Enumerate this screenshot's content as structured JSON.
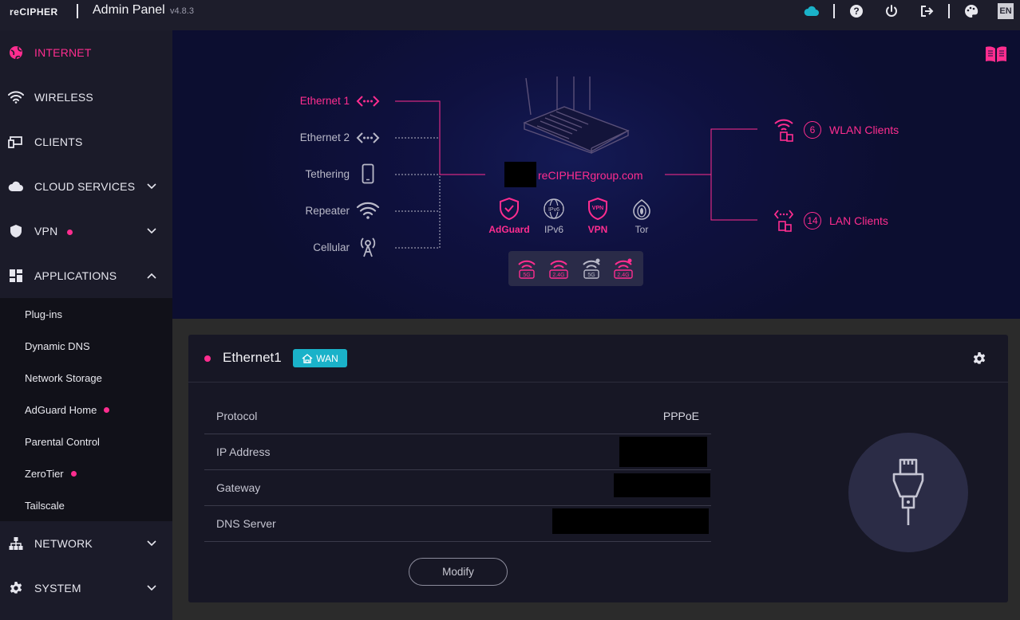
{
  "topbar": {
    "brand": "reCIPHER",
    "title": "Admin Panel",
    "version": "v4.8.3",
    "icons": [
      "cloud-icon",
      "help-icon",
      "power-icon",
      "logout-icon",
      "palette-icon"
    ],
    "language": "EN"
  },
  "sidebar": {
    "items": [
      {
        "label": "INTERNET",
        "icon": "globe-icon",
        "active": true
      },
      {
        "label": "WIRELESS",
        "icon": "wifi-icon"
      },
      {
        "label": "CLIENTS",
        "icon": "devices-icon"
      },
      {
        "label": "CLOUD SERVICES",
        "icon": "cloud-icon",
        "chevron": "down"
      },
      {
        "label": "VPN",
        "icon": "shield-icon",
        "chevron": "down",
        "dot": true
      },
      {
        "label": "APPLICATIONS",
        "icon": "apps-icon",
        "chevron": "up"
      },
      {
        "label": "NETWORK",
        "icon": "network-icon",
        "chevron": "down"
      },
      {
        "label": "SYSTEM",
        "icon": "gear-icon",
        "chevron": "down"
      }
    ],
    "submenu": [
      {
        "label": "Plug-ins"
      },
      {
        "label": "Dynamic DNS"
      },
      {
        "label": "Network Storage"
      },
      {
        "label": "AdGuard Home",
        "dot": true
      },
      {
        "label": "Parental Control"
      },
      {
        "label": "ZeroTier",
        "dot": true
      },
      {
        "label": "Tailscale"
      }
    ]
  },
  "hero": {
    "connections": [
      {
        "label": "Ethernet 1",
        "icon": "ethernet-icon",
        "active": true
      },
      {
        "label": "Ethernet 2",
        "icon": "ethernet-icon"
      },
      {
        "label": "Tethering",
        "icon": "phone-icon"
      },
      {
        "label": "Repeater",
        "icon": "wifi-icon"
      },
      {
        "label": "Cellular",
        "icon": "antenna-icon"
      }
    ],
    "hostname": "reCIPHERgroup.com",
    "features": [
      {
        "label": "AdGuard",
        "icon": "adguard-icon",
        "on": true
      },
      {
        "label": "IPv6",
        "icon": "ipv6-icon",
        "on": false
      },
      {
        "label": "VPN",
        "icon": "vpn-icon",
        "on": true
      },
      {
        "label": "Tor",
        "icon": "tor-icon",
        "on": false
      }
    ],
    "bands": [
      {
        "label": "5G",
        "on": true
      },
      {
        "label": "2.4G",
        "on": true
      },
      {
        "label": "5G",
        "on": false
      },
      {
        "label": "2.4G",
        "on": true
      }
    ],
    "clients": [
      {
        "count": "6",
        "label": "WLAN Clients",
        "icon": "wlan-client-icon"
      },
      {
        "count": "14",
        "label": "LAN Clients",
        "icon": "lan-client-icon"
      }
    ]
  },
  "card": {
    "title": "Ethernet1",
    "badge": "WAN",
    "rows": [
      {
        "key": "Protocol",
        "value": "PPPoE"
      },
      {
        "key": "IP Address",
        "value": ""
      },
      {
        "key": "Gateway",
        "value": ""
      },
      {
        "key": "DNS Server",
        "value": ""
      }
    ],
    "modify_label": "Modify"
  },
  "colors": {
    "accent": "#ff2d8f",
    "teal": "#1ab2c9",
    "sidebar": "#1b1b29",
    "hero": "#0f1140"
  }
}
